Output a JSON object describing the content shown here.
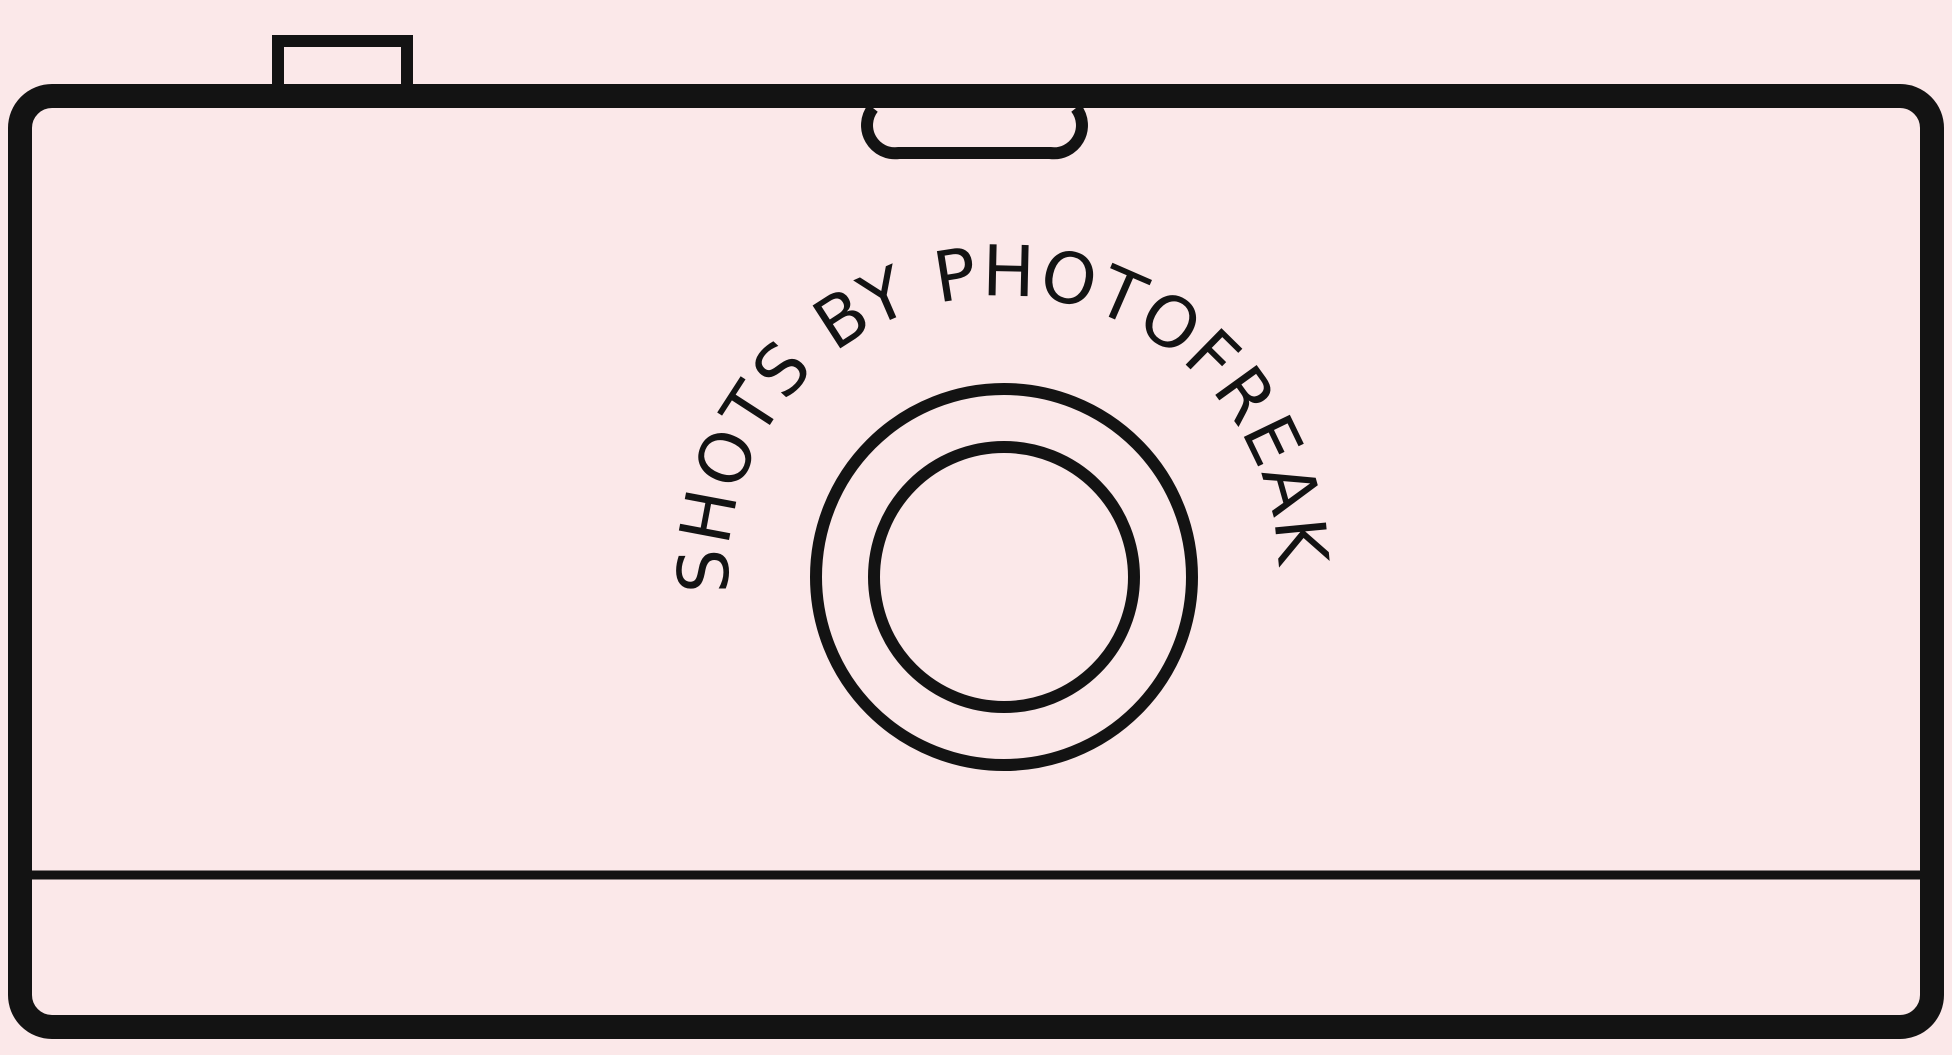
{
  "colors": {
    "background": "#fbe8e9",
    "ink": "#131313"
  },
  "logo": {
    "arc_text": "SHOTS BY PHOTOFREAK"
  },
  "icons": {
    "camera": "camera-outline-icon",
    "shutter": "shutter-button-icon",
    "viewfinder": "viewfinder-icon",
    "lens": "lens-icon"
  }
}
